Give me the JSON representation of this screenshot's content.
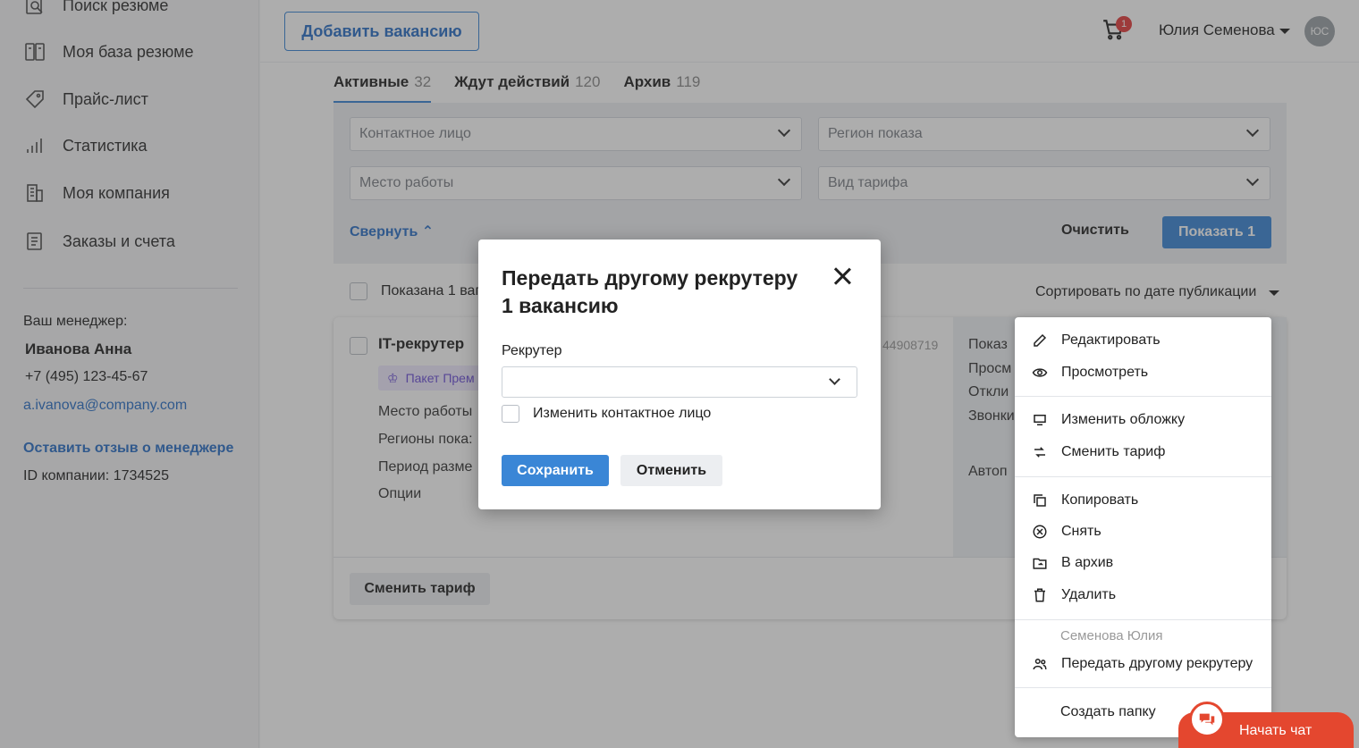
{
  "sidebar": {
    "items": [
      {
        "label": "Поиск резюме",
        "icon": "search-resume-icon"
      },
      {
        "label": "Моя база резюме",
        "icon": "resume-base-icon"
      },
      {
        "label": "Прайс-лист",
        "icon": "price-tag-icon"
      },
      {
        "label": "Статистика",
        "icon": "statistics-icon"
      },
      {
        "label": "Моя компания",
        "icon": "company-icon"
      },
      {
        "label": "Заказы и счета",
        "icon": "orders-icon"
      }
    ],
    "manager": {
      "caption": "Ваш менеджер:",
      "name": "Иванова Анна",
      "phone": "+7 (495) 123-45-67",
      "email": "a.ivanova@company.com",
      "feedback_link": "Оставить отзыв о менеджере",
      "company_id": "ID компании: 1734525"
    }
  },
  "header": {
    "add_vacancy": "Добавить вакансию",
    "cart_count": "1",
    "user_name": "Юлия Семенова",
    "avatar_initials": "ЮС"
  },
  "tabs": [
    {
      "label": "Активные",
      "count": "32"
    },
    {
      "label": "Ждут действий",
      "count": "120"
    },
    {
      "label": "Архив",
      "count": "119"
    }
  ],
  "filters": {
    "contact": "Контактное лицо",
    "region": "Регион показа",
    "workplace": "Место работы",
    "tariff": "Вид тарифа",
    "collapse": "Свернуть",
    "clear": "Очистить",
    "show": "Показать 1"
  },
  "list": {
    "shown": "Показана 1 ваг",
    "sort": "Сортировать по дате публикации"
  },
  "card": {
    "title": "IT-рекрутер",
    "badge": "Пакет Прем",
    "id_partial": "44908719",
    "rows": [
      "Место работы",
      "Регионы пока:",
      "Период разме",
      "Опции"
    ],
    "stats": [
      "Показ",
      "Просм",
      "Откли",
      "Звонки"
    ],
    "auto": "Автоп",
    "change_tariff": "Сменить тариф"
  },
  "menu": {
    "items": [
      {
        "label": "Редактировать",
        "icon": "pencil-icon"
      },
      {
        "label": "Просмотреть",
        "icon": "eye-icon"
      },
      {
        "label": "Изменить обложку",
        "icon": "cover-icon"
      },
      {
        "label": "Сменить тариф",
        "icon": "swap-icon"
      },
      {
        "label": "Копировать",
        "icon": "copy-icon"
      },
      {
        "label": "Снять",
        "icon": "cancel-circle-icon"
      },
      {
        "label": "В архив",
        "icon": "archive-icon"
      },
      {
        "label": "Удалить",
        "icon": "trash-icon"
      }
    ],
    "owner": "Семенова Юлия",
    "transfer": "Передать другому рекрутеру",
    "create_folder": "Создать папку"
  },
  "chat": {
    "label": "Начать чат"
  },
  "modal": {
    "title": "Передать другому рекрутеру 1 вакансию",
    "recruiter_label": "Рекрутер",
    "recruiter_value": "",
    "change_contact": "Изменить контактное лицо",
    "save": "Сохранить",
    "cancel": "Отменить"
  }
}
